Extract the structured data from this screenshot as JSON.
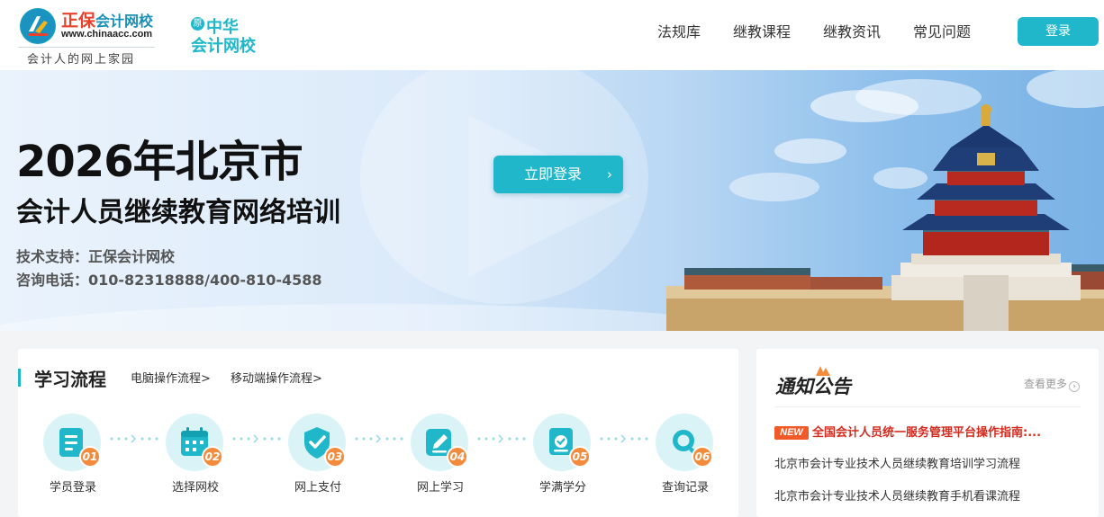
{
  "header": {
    "logo_name": "正保",
    "logo_name_rest": "会计网校",
    "logo_url": "www.chinaacc.com",
    "logo_slogan": "会计人的网上家园",
    "brand2_badge": "原",
    "brand2_line1": "中华",
    "brand2_line2": "会计网校",
    "nav": [
      "法规库",
      "继教课程",
      "继教资讯",
      "常见问题"
    ],
    "login_label": "登录"
  },
  "banner": {
    "title": "2026年北京市",
    "subtitle": "会计人员继续教育网络培训",
    "support": "技术支持：正保会计网校",
    "phone": "咨询电话：010-82318888/400-810-4588",
    "button_label": "立即登录",
    "button_arrow": "›"
  },
  "process": {
    "title": "学习流程",
    "links": [
      "电脑操作流程>",
      "移动端操作流程>"
    ],
    "steps": [
      {
        "num": "01",
        "label": "学员登录",
        "icon": "document-icon"
      },
      {
        "num": "02",
        "label": "选择网校",
        "icon": "calendar-icon"
      },
      {
        "num": "03",
        "label": "网上支付",
        "icon": "shield-check-icon"
      },
      {
        "num": "04",
        "label": "网上学习",
        "icon": "edit-icon"
      },
      {
        "num": "05",
        "label": "学满学分",
        "icon": "certificate-icon"
      },
      {
        "num": "06",
        "label": "查询记录",
        "icon": "search-icon"
      }
    ],
    "accent": "#1fb7c9",
    "badge_color": "#f28b3c"
  },
  "notice": {
    "title": "通知公告",
    "more_label": "查看更多",
    "more_icon": "›",
    "new_tag": "NEW",
    "items": [
      "全国会计人员统一服务管理平台操作指南:...",
      "北京市会计专业技术人员继续教育培训学习流程",
      "北京市会计专业技术人员继续教育手机看课流程"
    ],
    "highlight_color": "#d42a1e"
  }
}
